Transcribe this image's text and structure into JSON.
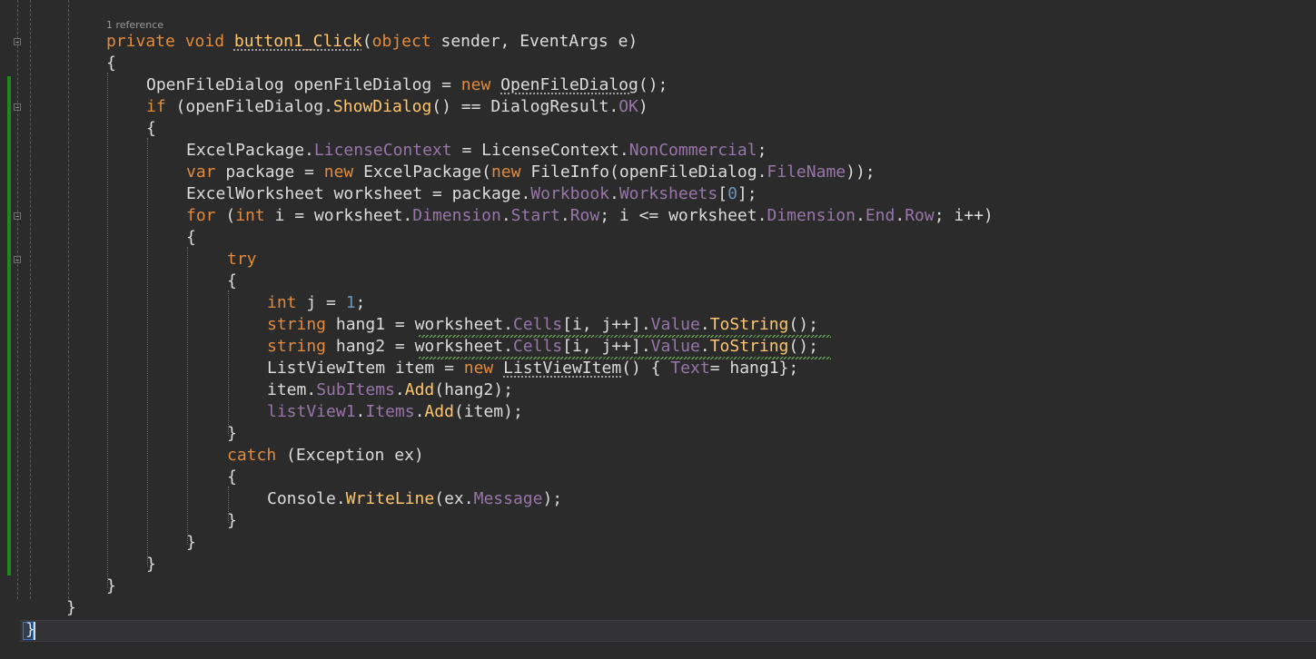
{
  "editor": {
    "codelens": "1 reference",
    "lines": [
      [
        {
          "t": "private",
          "c": "k"
        },
        {
          "t": " ",
          "c": "d"
        },
        {
          "t": "void",
          "c": "k"
        },
        {
          "t": " ",
          "c": "d"
        },
        {
          "t": "button1_Click",
          "c": "m u"
        },
        {
          "t": "(",
          "c": "d"
        },
        {
          "t": "object",
          "c": "k"
        },
        {
          "t": " sender, EventArgs e)",
          "c": "d"
        }
      ],
      [
        {
          "t": "{",
          "c": "d"
        }
      ],
      [
        {
          "t": "OpenFileDialog openFileDialog = ",
          "c": "d"
        },
        {
          "t": "new",
          "c": "k"
        },
        {
          "t": " ",
          "c": "d"
        },
        {
          "t": "OpenFileDialog",
          "c": "d u"
        },
        {
          "t": "();",
          "c": "d"
        }
      ],
      [
        {
          "t": "if",
          "c": "k"
        },
        {
          "t": " (openFileDialog.",
          "c": "d"
        },
        {
          "t": "ShowDialog",
          "c": "m"
        },
        {
          "t": "() == DialogResult.",
          "c": "d"
        },
        {
          "t": "OK",
          "c": "p"
        },
        {
          "t": ")",
          "c": "d"
        }
      ],
      [
        {
          "t": "{",
          "c": "d"
        }
      ],
      [
        {
          "t": "ExcelPackage.",
          "c": "d"
        },
        {
          "t": "LicenseContext",
          "c": "p"
        },
        {
          "t": " = LicenseContext.",
          "c": "d"
        },
        {
          "t": "NonCommercial",
          "c": "p"
        },
        {
          "t": ";",
          "c": "d"
        }
      ],
      [
        {
          "t": "var",
          "c": "k"
        },
        {
          "t": " package = ",
          "c": "d"
        },
        {
          "t": "new",
          "c": "k"
        },
        {
          "t": " ExcelPackage(",
          "c": "d"
        },
        {
          "t": "new",
          "c": "k"
        },
        {
          "t": " FileInfo(openFileDialog.",
          "c": "d"
        },
        {
          "t": "FileName",
          "c": "p"
        },
        {
          "t": "));",
          "c": "d"
        }
      ],
      [
        {
          "t": "ExcelWorksheet worksheet = package.",
          "c": "d"
        },
        {
          "t": "Workbook",
          "c": "p"
        },
        {
          "t": ".",
          "c": "d"
        },
        {
          "t": "Worksheets",
          "c": "p"
        },
        {
          "t": "[",
          "c": "d"
        },
        {
          "t": "0",
          "c": "n"
        },
        {
          "t": "];",
          "c": "d"
        }
      ],
      [
        {
          "t": "for",
          "c": "k"
        },
        {
          "t": " (",
          "c": "d"
        },
        {
          "t": "int",
          "c": "k"
        },
        {
          "t": " i = worksheet.",
          "c": "d"
        },
        {
          "t": "Dimension",
          "c": "p"
        },
        {
          "t": ".",
          "c": "d"
        },
        {
          "t": "Start",
          "c": "p"
        },
        {
          "t": ".",
          "c": "d"
        },
        {
          "t": "Row",
          "c": "p"
        },
        {
          "t": "; i <= worksheet.",
          "c": "d"
        },
        {
          "t": "Dimension",
          "c": "p"
        },
        {
          "t": ".",
          "c": "d"
        },
        {
          "t": "End",
          "c": "p"
        },
        {
          "t": ".",
          "c": "d"
        },
        {
          "t": "Row",
          "c": "p"
        },
        {
          "t": "; i++)",
          "c": "d"
        }
      ],
      [
        {
          "t": "{",
          "c": "d"
        }
      ],
      [
        {
          "t": "try",
          "c": "k"
        }
      ],
      [
        {
          "t": "{",
          "c": "d"
        }
      ],
      [
        {
          "t": "int",
          "c": "k"
        },
        {
          "t": " j = ",
          "c": "d"
        },
        {
          "t": "1",
          "c": "n"
        },
        {
          "t": ";",
          "c": "d"
        }
      ],
      [
        {
          "t": "string",
          "c": "k"
        },
        {
          "t": " hang1 = worksheet.",
          "c": "d"
        },
        {
          "t": "Cells",
          "c": "p"
        },
        {
          "t": "[i, j++].",
          "c": "d"
        },
        {
          "t": "Value",
          "c": "p"
        },
        {
          "t": ".",
          "c": "d"
        },
        {
          "t": "ToString",
          "c": "m"
        },
        {
          "t": "();",
          "c": "d"
        }
      ],
      [
        {
          "t": "string",
          "c": "k"
        },
        {
          "t": " hang2 = worksheet.",
          "c": "d"
        },
        {
          "t": "Cells",
          "c": "p"
        },
        {
          "t": "[i, j++].",
          "c": "d"
        },
        {
          "t": "Value",
          "c": "p"
        },
        {
          "t": ".",
          "c": "d"
        },
        {
          "t": "ToString",
          "c": "m"
        },
        {
          "t": "();",
          "c": "d"
        }
      ],
      [
        {
          "t": "ListViewItem item = ",
          "c": "d"
        },
        {
          "t": "new",
          "c": "k"
        },
        {
          "t": " ",
          "c": "d"
        },
        {
          "t": "ListViewItem",
          "c": "d u"
        },
        {
          "t": "() { ",
          "c": "d"
        },
        {
          "t": "Text",
          "c": "p"
        },
        {
          "t": "= hang1};",
          "c": "d"
        }
      ],
      [
        {
          "t": "item.",
          "c": "d"
        },
        {
          "t": "SubItems",
          "c": "p"
        },
        {
          "t": ".",
          "c": "d"
        },
        {
          "t": "Add",
          "c": "m"
        },
        {
          "t": "(hang2);",
          "c": "d"
        }
      ],
      [
        {
          "t": "listView1",
          "c": "p"
        },
        {
          "t": ".",
          "c": "d"
        },
        {
          "t": "Items",
          "c": "p"
        },
        {
          "t": ".",
          "c": "d"
        },
        {
          "t": "Add",
          "c": "m"
        },
        {
          "t": "(item);",
          "c": "d"
        }
      ],
      [
        {
          "t": "}",
          "c": "d"
        }
      ],
      [
        {
          "t": "catch",
          "c": "k"
        },
        {
          "t": " (Exception ex)",
          "c": "d"
        }
      ],
      [
        {
          "t": "{",
          "c": "d"
        }
      ],
      [
        {
          "t": "Console.",
          "c": "d"
        },
        {
          "t": "WriteLine",
          "c": "m"
        },
        {
          "t": "(ex.",
          "c": "d"
        },
        {
          "t": "Message",
          "c": "p"
        },
        {
          "t": ");",
          "c": "d"
        }
      ],
      [
        {
          "t": "}",
          "c": "d"
        }
      ],
      [
        {
          "t": "}",
          "c": "d"
        }
      ],
      [
        {
          "t": "}",
          "c": "d"
        }
      ],
      [
        {
          "t": "}",
          "c": "d"
        }
      ],
      [
        {
          "t": "}",
          "c": "d"
        }
      ],
      [
        {
          "t": "}",
          "c": "d"
        }
      ]
    ]
  },
  "colors": {
    "background": "#2b2b2b",
    "keyword": "#e38b3c",
    "method": "#ffc66d",
    "property": "#9876aa",
    "number": "#6897bb",
    "default": "#dcdcdc",
    "change_bar": "#1e8a1e"
  }
}
